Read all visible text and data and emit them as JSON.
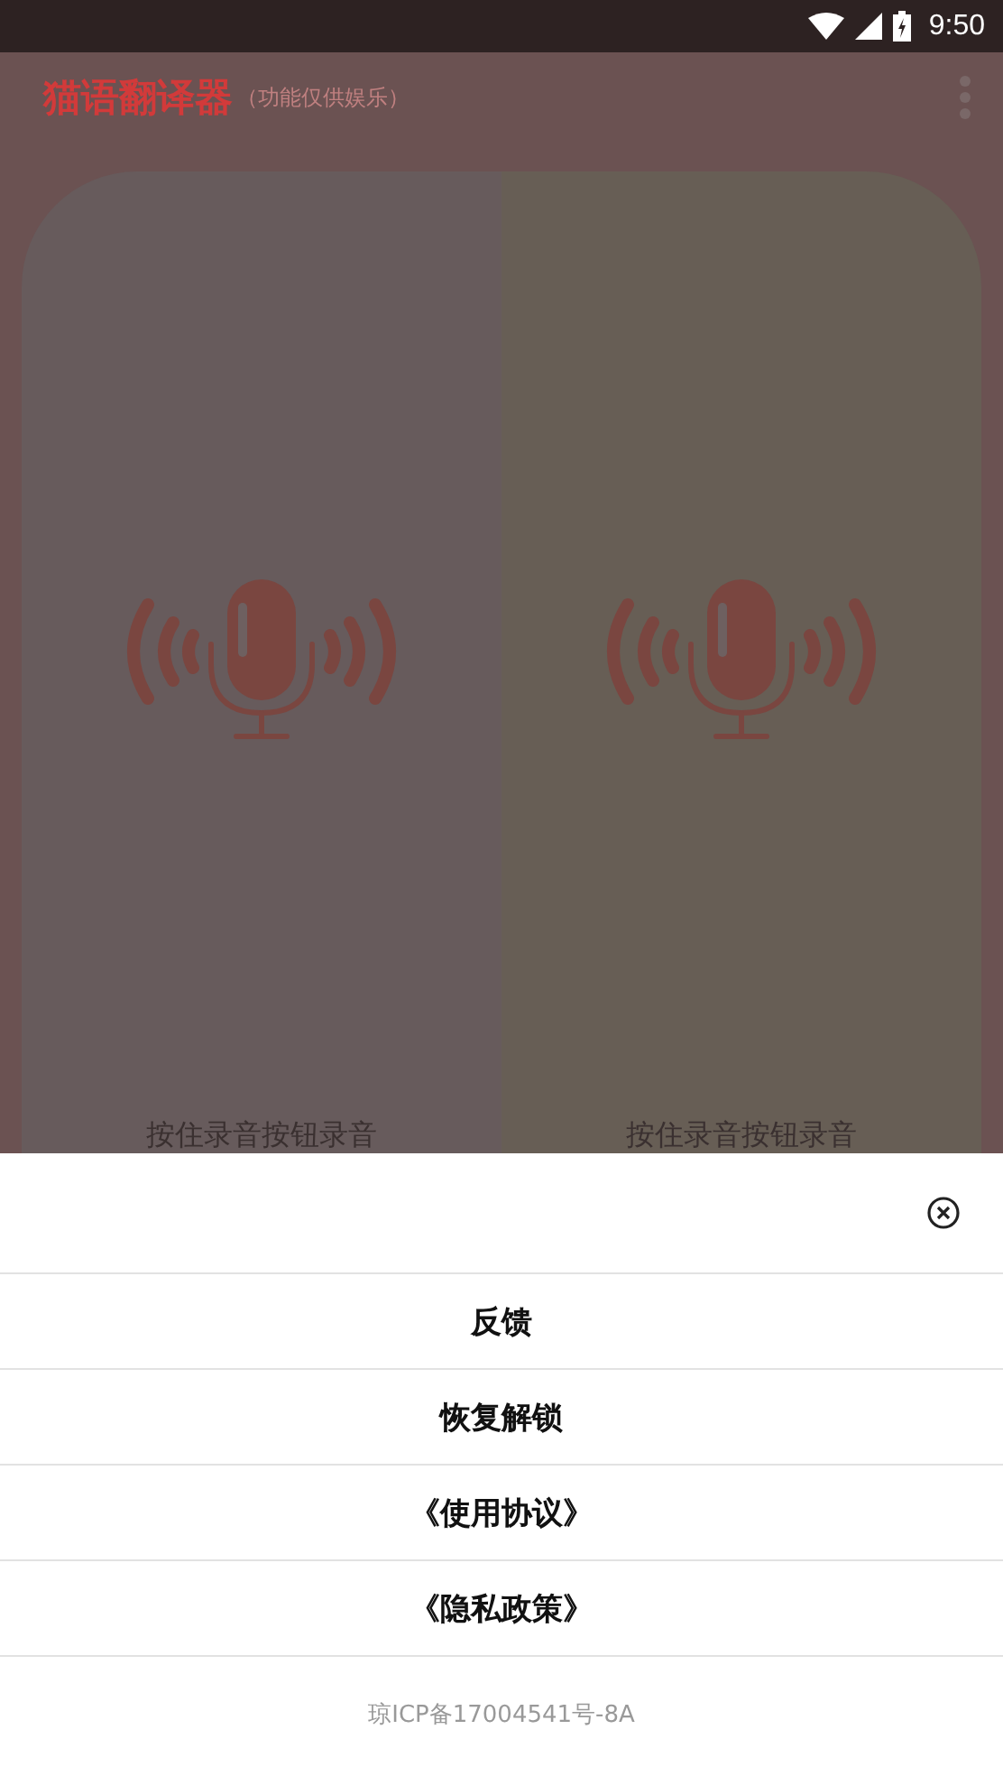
{
  "status_bar": {
    "time": "9:50"
  },
  "app_bar": {
    "title": "猫语翻译器",
    "subtitle": "（功能仅供娱乐）"
  },
  "panels": [
    {
      "hint": "按住录音按钮录音",
      "color": "#675b5c"
    },
    {
      "hint": "按住录音按钮录音",
      "color": "#675e55"
    }
  ],
  "sheet": {
    "items": [
      "反馈",
      "恢复解锁",
      "《使用协议》",
      "《隐私政策》"
    ],
    "footer": "琼ICP备17004541号-8A"
  }
}
